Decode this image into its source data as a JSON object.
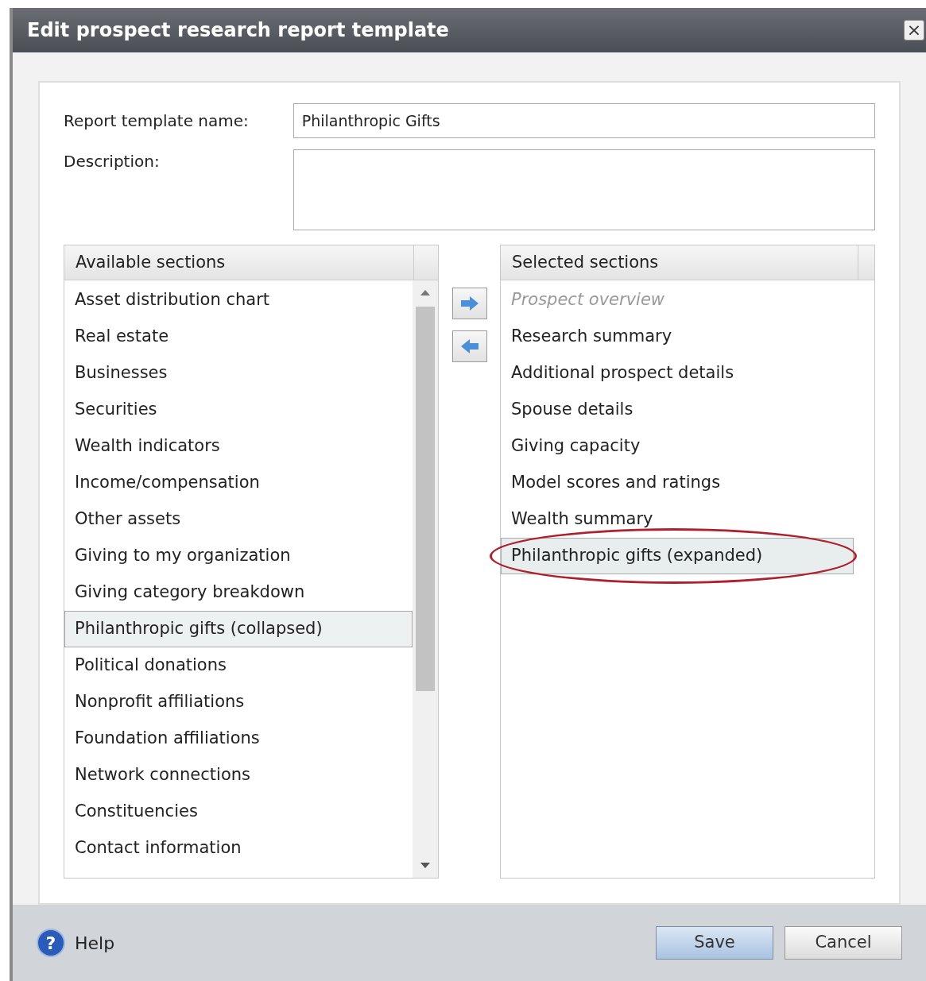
{
  "window": {
    "title": "Edit prospect research report template",
    "close": "×"
  },
  "form": {
    "name_label": "Report template name:",
    "name_value": "Philanthropic Gifts",
    "description_label": "Description:"
  },
  "available": {
    "header": "Available sections",
    "items": [
      {
        "label": "Asset distribution chart",
        "selected": false
      },
      {
        "label": "Real estate",
        "selected": false
      },
      {
        "label": "Businesses",
        "selected": false
      },
      {
        "label": "Securities",
        "selected": false
      },
      {
        "label": "Wealth indicators",
        "selected": false
      },
      {
        "label": "Income/compensation",
        "selected": false
      },
      {
        "label": "Other assets",
        "selected": false
      },
      {
        "label": "Giving to my organization",
        "selected": false
      },
      {
        "label": "Giving category breakdown",
        "selected": false
      },
      {
        "label": "Philanthropic gifts (collapsed)",
        "selected": true
      },
      {
        "label": "Political donations",
        "selected": false
      },
      {
        "label": "Nonprofit affiliations",
        "selected": false
      },
      {
        "label": "Foundation affiliations",
        "selected": false
      },
      {
        "label": "Network connections",
        "selected": false
      },
      {
        "label": "Constituencies",
        "selected": false
      },
      {
        "label": "Contact information",
        "selected": false
      }
    ]
  },
  "selected_sections": {
    "header": "Selected sections",
    "items": [
      {
        "label": "Prospect overview",
        "disabled": true,
        "selected": false,
        "circled": false
      },
      {
        "label": "Research summary",
        "disabled": false,
        "selected": false,
        "circled": false
      },
      {
        "label": "Additional prospect details",
        "disabled": false,
        "selected": false,
        "circled": false
      },
      {
        "label": "Spouse details",
        "disabled": false,
        "selected": false,
        "circled": false
      },
      {
        "label": "Giving capacity",
        "disabled": false,
        "selected": false,
        "circled": false
      },
      {
        "label": "Model scores and ratings",
        "disabled": false,
        "selected": false,
        "circled": false
      },
      {
        "label": "Wealth summary",
        "disabled": false,
        "selected": false,
        "circled": false
      },
      {
        "label": "Philanthropic gifts (expanded)",
        "disabled": false,
        "selected": true,
        "circled": true
      }
    ]
  },
  "footer": {
    "help": "Help",
    "help_icon": "?",
    "buttons": [
      {
        "label": "Save",
        "kind": "primary"
      },
      {
        "label": "Cancel",
        "kind": "secondary"
      }
    ]
  }
}
